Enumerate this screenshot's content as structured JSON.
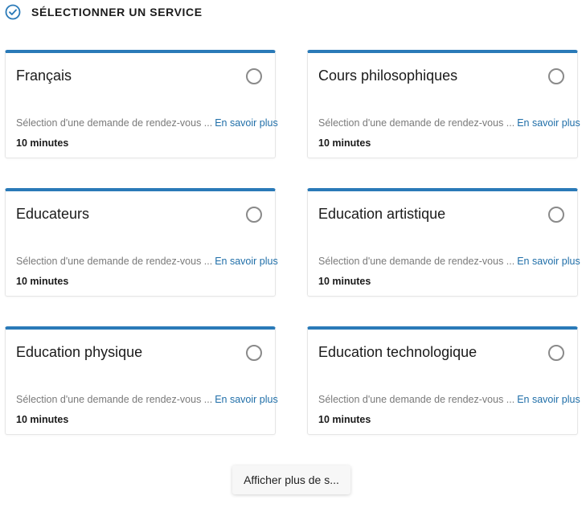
{
  "header": {
    "title": "SÉLECTIONNER UN SERVICE",
    "icon": "check-circle-icon",
    "accent_color": "#2a7ab8"
  },
  "services": [
    {
      "title": "Français",
      "description": "Sélection d'une demande de rendez-vous ...",
      "more_link": "En savoir plus",
      "duration": "10 minutes",
      "selected": false
    },
    {
      "title": "Cours philosophiques",
      "description": "Sélection d'une demande de rendez-vous ...",
      "more_link": "En savoir plus",
      "duration": "10 minutes",
      "selected": false
    },
    {
      "title": "Educateurs",
      "description": "Sélection d'une demande de rendez-vous ...",
      "more_link": "En savoir plus",
      "duration": "10 minutes",
      "selected": false
    },
    {
      "title": "Education artistique",
      "description": "Sélection d'une demande de rendez-vous ...",
      "more_link": "En savoir plus",
      "duration": "10 minutes",
      "selected": false
    },
    {
      "title": "Education physique",
      "description": "Sélection d'une demande de rendez-vous ...",
      "more_link": "En savoir plus",
      "duration": "10 minutes",
      "selected": false
    },
    {
      "title": "Education technologique",
      "description": "Sélection d'une demande de rendez-vous ...",
      "more_link": "En savoir plus",
      "duration": "10 minutes",
      "selected": false
    }
  ],
  "show_more_button": {
    "label": "Afficher plus de s..."
  },
  "colors": {
    "card_top_border": "#2a7ab8",
    "link": "#1f6ea8",
    "description": "#7a7a7a"
  }
}
